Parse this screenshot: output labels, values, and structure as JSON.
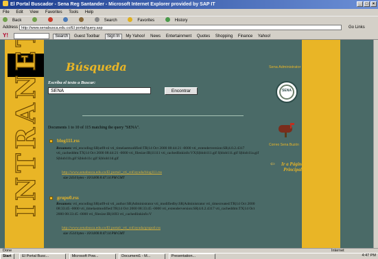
{
  "window": {
    "title": "El Portal Buscador - Sena Reg Santander - Microsoft Internet Explorer provided by SAP IT"
  },
  "menu": [
    "File",
    "Edit",
    "View",
    "Favorites",
    "Tools",
    "Help"
  ],
  "toolbar": {
    "back": "Back",
    "search": "Search",
    "favorites": "Favorites",
    "history": "History"
  },
  "address": {
    "label": "Address",
    "url": "http://www.senabusca.edu.co/El portal/query.asp",
    "go": "Go",
    "links": "Links"
  },
  "yahoo": {
    "logo": "Y!",
    "search_btn": "Search",
    "guest": "Guest Toolbar",
    "signin": "Sign In",
    "items": [
      "My Yahoo!",
      "News",
      "Entertainment",
      "Quotes",
      "Shopping",
      "Finance",
      "Yahoo!"
    ]
  },
  "side": {
    "banner": "INTRANET",
    "admin": "Sena Administrator",
    "mailbox": "Correo Sena Buzón",
    "back_arrow": "⇦",
    "main_link": "Ir a Página Principal"
  },
  "page": {
    "heading": "Búsqueda",
    "search_label": "Escriba el texto a Buscar:",
    "search_value": "SENA",
    "search_button": "Encontrar",
    "summary": "Documents 1 to 10 of 115 matching the query \"SENA\"."
  },
  "results": [
    {
      "title": "blog111.rss",
      "label": "Resumen:",
      "body": "vti_encoding:SR|utf8-nl vti_timelastmodified:TR|14 Oct 2000 08:44:21 -0000 vti_extenderversion:SR|4.0.2.4317 vti_cacheddtm:TX|14 Oct 2000 08:44:21 -0000 vti_filesize:IR|11111 vti_cachedlinkinfo:VX|S|blob111.gif S|blob111.gif S|blob11a.gif S|blob11b.gif S|blob11c.gif S|blob11d.gif",
      "url": "http://www.senabusca.edu.co/El portal/_vti_cnf/ayuda/blog111.rss",
      "size": "size 2414 bytes - 10/14/00 8:47:14 PM GMT"
    },
    {
      "title": "grupo0.rss",
      "label": "Resumen:",
      "body": "vti_encoding:SR|utf8-nl vti_author:SR|Administrator vti_modifiedby:SR|Administrator vti_timecreated:TR|14 Oct 2000 08:33:45 -0000 vti_timelastmodified:TR|14 Oct 2000 08:33:45 -0000 vti_extenderversion:SR|4.0.2.4317 vti_cacheddtm:TX|14 Oct 2000 08:33:45 -0000 vti_filesize:IR|1693 vti_cachedlinkinfo:V",
      "url": "http://www.senabusca.edu.co/El portal/_vti_cnf/ayuda/grupo0.rss",
      "size": "size 1514 bytes - 10/14/00 8:47:14 PM GMT"
    }
  ],
  "status": {
    "text": "Done",
    "zone": "Internet"
  },
  "taskbar": {
    "start": "Start",
    "tasks": [
      "El Portal Busc...",
      "Microsoft Pow...",
      "Document1 - M...",
      "Presentation..."
    ],
    "clock": "4:47 PM"
  },
  "colors": {
    "content_bg": "#4a6a67",
    "accent": "#e9b526",
    "titlebar": "#1c3d8e"
  }
}
